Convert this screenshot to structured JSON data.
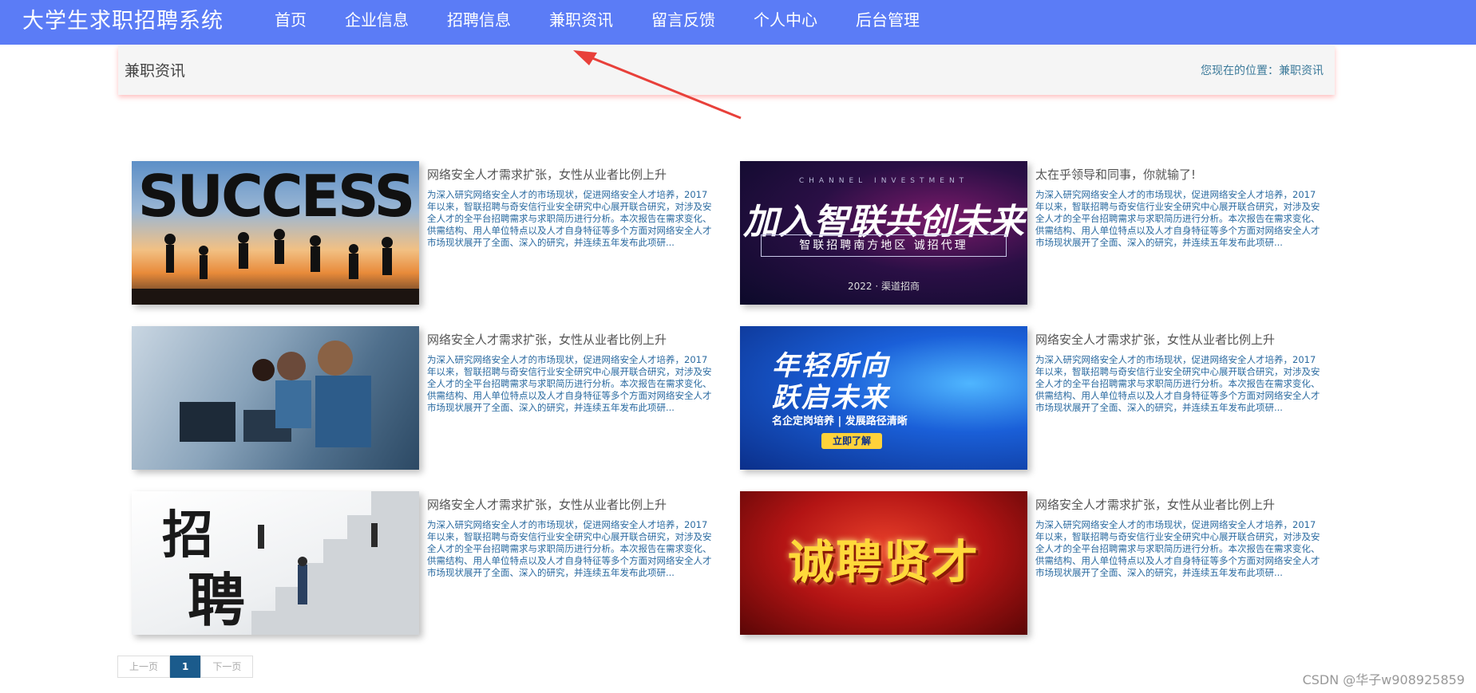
{
  "app": {
    "title": "大学生求职招聘系统"
  },
  "nav": {
    "items": [
      {
        "label": "首页"
      },
      {
        "label": "企业信息"
      },
      {
        "label": "招聘信息"
      },
      {
        "label": "兼职资讯"
      },
      {
        "label": "留言反馈"
      },
      {
        "label": "个人中心"
      },
      {
        "label": "后台管理"
      }
    ],
    "active": "兼职资讯"
  },
  "breadcrumb": {
    "title": "兼职资讯",
    "location": "您现在的位置：兼职资讯"
  },
  "articles": [
    {
      "title": "网络安全人才需求扩张，女性从业者比例上升",
      "desc": "为深入研究网络安全人才的市场现状，促进网络安全人才培养，2017年以来，智联招聘与奇安信行业安全研究中心展开联合研究，对涉及安全人才的全平台招聘需求与求职简历进行分析。本次报告在需求变化、供需结构、用人单位特点以及人才自身特征等多个方面对网络安全人才市场现状展开了全面、深入的研究，并连续五年发布此项研...",
      "image_text": "SUCCESS"
    },
    {
      "title": "太在乎领导和同事，你就输了!",
      "desc": "为深入研究网络安全人才的市场现状，促进网络安全人才培养，2017年以来，智联招聘与奇安信行业安全研究中心展开联合研究，对涉及安全人才的全平台招聘需求与求职简历进行分析。本次报告在需求变化、供需结构、用人单位特点以及人才自身特征等多个方面对网络安全人才市场现状展开了全面、深入的研究，并连续五年发布此项研...",
      "image_text": "加入智联共创未来",
      "image_sub": "智联招聘南方地区 诚招代理",
      "image_top": "CHANNEL INVESTMENT",
      "image_year": "2022 · 渠道招商"
    },
    {
      "title": "网络安全人才需求扩张，女性从业者比例上升",
      "desc": "为深入研究网络安全人才的市场现状，促进网络安全人才培养，2017年以来，智联招聘与奇安信行业安全研究中心展开联合研究，对涉及安全人才的全平台招聘需求与求职简历进行分析。本次报告在需求变化、供需结构、用人单位特点以及人才自身特征等多个方面对网络安全人才市场现状展开了全面、深入的研究，并连续五年发布此项研..."
    },
    {
      "title": "网络安全人才需求扩张，女性从业者比例上升",
      "desc": "为深入研究网络安全人才的市场现状，促进网络安全人才培养，2017年以来，智联招聘与奇安信行业安全研究中心展开联合研究，对涉及安全人才的全平台招聘需求与求职简历进行分析。本次报告在需求变化、供需结构、用人单位特点以及人才自身特征等多个方面对网络安全人才市场现状展开了全面、深入的研究，并连续五年发布此项研...",
      "image_text": "年轻所向",
      "image_text2": "跃启未来",
      "image_sub": "名企定岗培养 | 发展路径清晰",
      "image_btn": "立即了解"
    },
    {
      "title": "网络安全人才需求扩张，女性从业者比例上升",
      "desc": "为深入研究网络安全人才的市场现状，促进网络安全人才培养，2017年以来，智联招聘与奇安信行业安全研究中心展开联合研究，对涉及安全人才的全平台招聘需求与求职简历进行分析。本次报告在需求变化、供需结构、用人单位特点以及人才自身特征等多个方面对网络安全人才市场现状展开了全面、深入的研究，并连续五年发布此项研...",
      "image_text": "招",
      "image_text2": "聘"
    },
    {
      "title": "网络安全人才需求扩张，女性从业者比例上升",
      "desc": "为深入研究网络安全人才的市场现状，促进网络安全人才培养，2017年以来，智联招聘与奇安信行业安全研究中心展开联合研究，对涉及安全人才的全平台招聘需求与求职简历进行分析。本次报告在需求变化、供需结构、用人单位特点以及人才自身特征等多个方面对网络安全人才市场现状展开了全面、深入的研究，并连续五年发布此项研...",
      "image_text": "诚聘贤才"
    }
  ],
  "pagination": {
    "prev": "上一页",
    "current": "1",
    "next": "下一页"
  },
  "watermark": "CSDN @华子w908925859",
  "colors": {
    "nav_bg": "#5b7cf6",
    "link": "#2a6aa0",
    "page_active": "#1b5b8c"
  }
}
